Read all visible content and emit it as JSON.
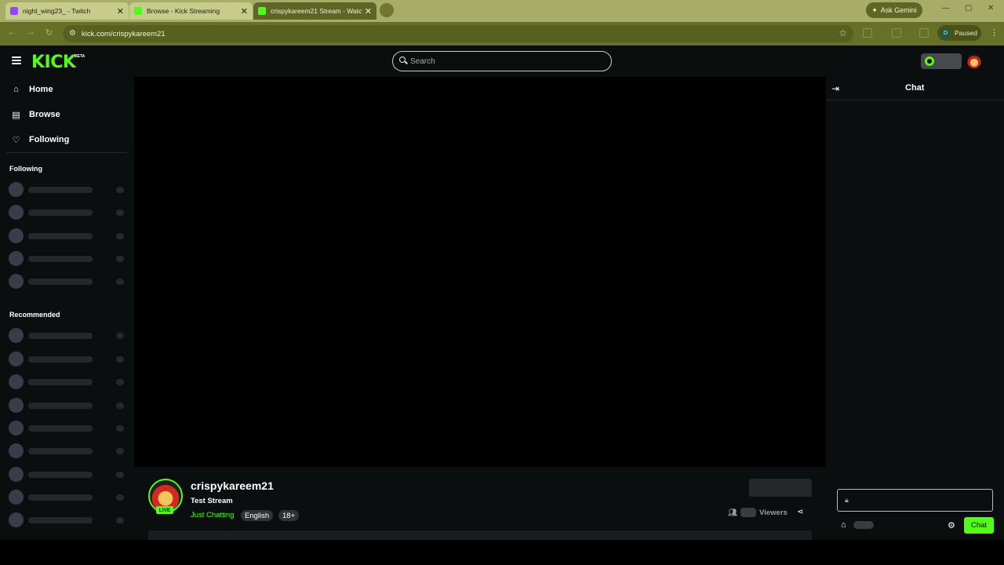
{
  "browser": {
    "tabs": [
      {
        "title": "night_wing23_ - Twitch",
        "active": false,
        "favicon_color": "#9147ff"
      },
      {
        "title": "Browse - Kick Streaming",
        "active": false,
        "favicon_color": "#53fc18"
      },
      {
        "title": "crispykareem21 Stream - Watc",
        "active": true,
        "favicon_color": "#53fc18"
      }
    ],
    "ask_gemini": "Ask Gemini",
    "url": "kick.com/crispykareem21",
    "profile_initial": "D",
    "profile_status": "Paused"
  },
  "header": {
    "logo": "KICK",
    "beta": "BETA",
    "search_placeholder": "Search"
  },
  "sidebar": {
    "nav": [
      {
        "label": "Home",
        "icon": "home-icon"
      },
      {
        "label": "Browse",
        "icon": "browse-icon"
      },
      {
        "label": "Following",
        "icon": "heart-icon"
      }
    ],
    "following_heading": "Following",
    "recommended_heading": "Recommended"
  },
  "stream": {
    "username": "crispykareem21",
    "title": "Test Stream",
    "category": "Just Chatting",
    "tags": [
      "English",
      "18+"
    ],
    "live_badge": "LIVE",
    "viewers_label": "Viewers"
  },
  "chat": {
    "title": "Chat",
    "send_label": "Chat"
  },
  "colors": {
    "accent": "#53fc18",
    "background": "#0b0e0f"
  }
}
